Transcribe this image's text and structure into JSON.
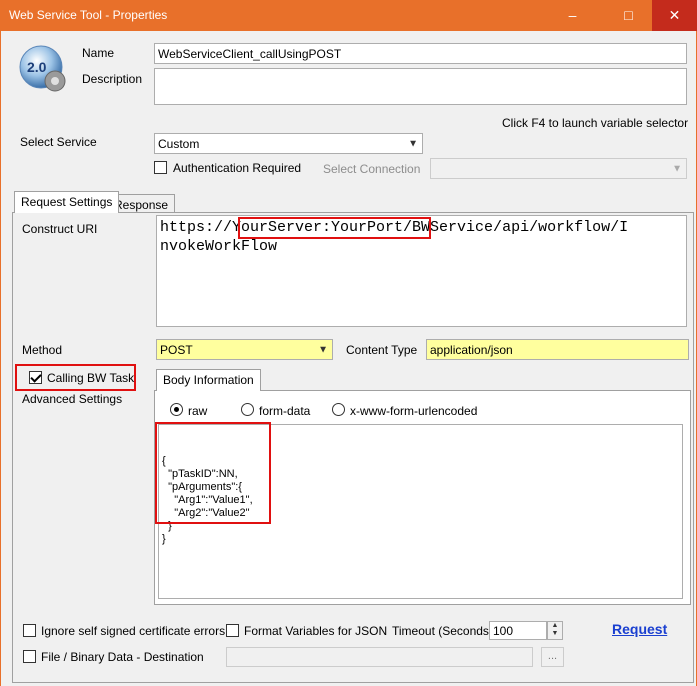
{
  "window": {
    "title": "Web Service Tool - Properties",
    "minimize": "–",
    "maximize": "□",
    "close": "✕"
  },
  "logo": {
    "badge": "2.0"
  },
  "fields": {
    "name_label": "Name",
    "name_value": "WebServiceClient_callUsingPOST",
    "description_label": "Description",
    "description_value": ""
  },
  "hint": "Click F4 to launch variable selector",
  "service": {
    "label": "Select Service",
    "value": "Custom",
    "auth_label": "Authentication Required",
    "auth_checked": false,
    "connection_label": "Select Connection",
    "connection_value": ""
  },
  "tabs": [
    {
      "label": "Request Settings",
      "active": true
    },
    {
      "label": "Response",
      "active": false
    }
  ],
  "request": {
    "uri_label": "Construct URI",
    "uri_prefix": "https://",
    "uri_highlight": "YourServer:YourPort",
    "uri_suffix": "/BWService/api/workflow/I",
    "uri_line2": "nvokeWorkFlow",
    "method_label": "Method",
    "method_value": "POST",
    "content_type_label": "Content Type",
    "content_type_value": "application/json",
    "calling_bw_label": "Calling BW Task",
    "calling_bw_checked": true,
    "advanced_label": "Advanced Settings"
  },
  "body": {
    "tab_label": "Body Information",
    "options": [
      {
        "label": "raw",
        "checked": true
      },
      {
        "label": "form-data",
        "checked": false
      },
      {
        "label": "x-www-form-urlencoded",
        "checked": false
      }
    ],
    "content": "{\n  \"pTaskID\":NN,\n  \"pArguments\":{\n    \"Arg1\":\"Value1\",\n    \"Arg2\":\"Value2\"\n  }\n}"
  },
  "footer": {
    "ignore_ssl_label": "Ignore self signed certificate errors",
    "format_vars_label": "Format Variables for JSON",
    "timeout_label": "Timeout (Seconds)",
    "timeout_value": "100",
    "request_link": "Request",
    "file_binary_label": "File / Binary Data - Destination",
    "file_value": "",
    "browse_label": "..."
  },
  "colors": {
    "titlebar": "#e8702a",
    "close": "#c42b1c",
    "highlight": "#ffff9e",
    "annotation": "#e01010",
    "link": "#1a3fd0"
  }
}
